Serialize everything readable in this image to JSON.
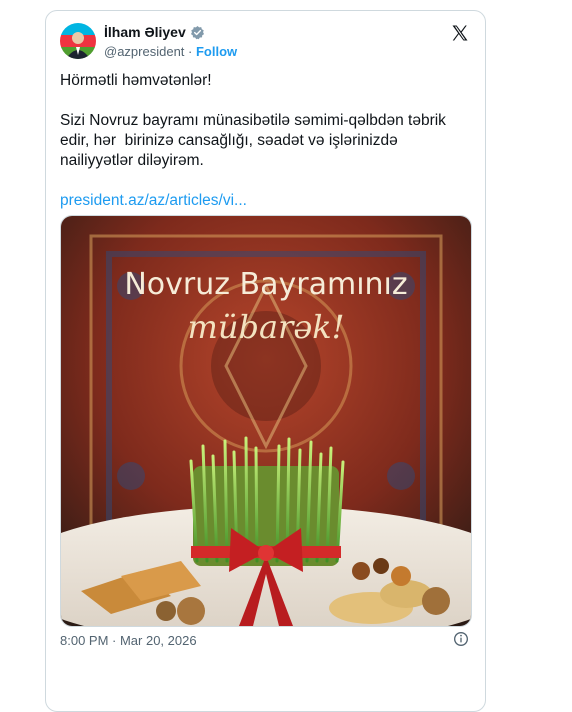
{
  "author": {
    "display_name": "İlham Əliyev",
    "handle": "@azpresident",
    "separator": " · ",
    "follow_label": "Follow"
  },
  "tweet": {
    "greeting": "Hörmətli həmvətənlər!",
    "message": "Sizi Novruz bayramı münasibətilə səmimi-qəlbdən təbrik edir, hər  birinizə cansağlığı, səadət və işlərinizdə nailiyyətlər diləyirəm.",
    "link_text": "president.az/az/articles/vi..."
  },
  "media": {
    "headline": "Novruz Bayramınız",
    "script_text": "mübarək!"
  },
  "meta": {
    "timestamp": "8:00 PM · Mar 20, 2026"
  },
  "colors": {
    "accent": "#1d9bf0",
    "text": "#0f1419",
    "muted": "#536471"
  }
}
